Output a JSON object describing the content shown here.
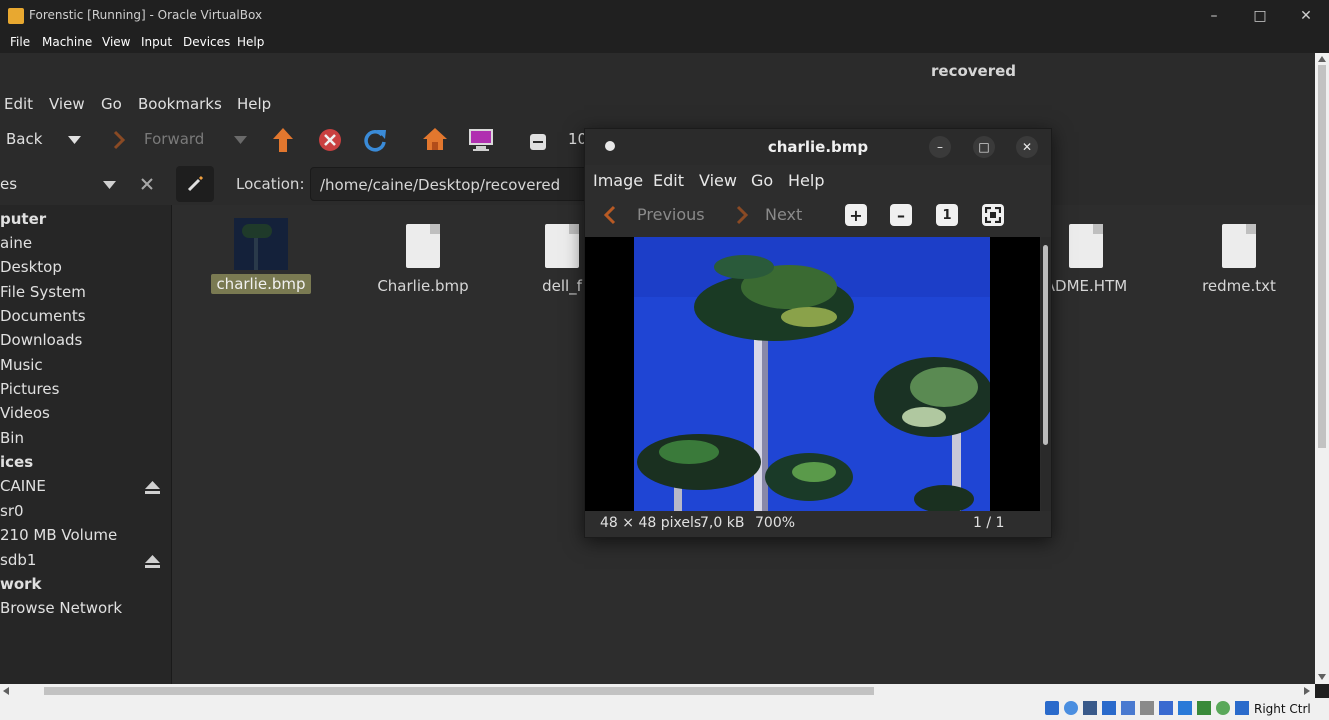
{
  "host_window": {
    "title": "Forenstic [Running] - Oracle VirtualBox",
    "menu": [
      "File",
      "Machine",
      "View",
      "Input",
      "Devices",
      "Help"
    ],
    "status_right": "Right Ctrl"
  },
  "guest": {
    "header_title": "recovered",
    "menu": [
      "Edit",
      "View",
      "Go",
      "Bookmarks",
      "Help"
    ],
    "toolbar": {
      "back_label": "Back",
      "forward_label": "Forward",
      "zoom_partial": "10"
    },
    "location": {
      "label": "Location:",
      "value": "/home/caine/Desktop/recovered"
    },
    "sidebar": {
      "places_label": "es",
      "items": [
        {
          "label": "puter",
          "header": true
        },
        {
          "label": "aine"
        },
        {
          "label": "Desktop"
        },
        {
          "label": "File System"
        },
        {
          "label": "Documents"
        },
        {
          "label": "Downloads"
        },
        {
          "label": "Music"
        },
        {
          "label": "Pictures"
        },
        {
          "label": "Videos"
        },
        {
          "label": "Bin"
        },
        {
          "label": "ices",
          "header": true
        },
        {
          "label": "CAINE",
          "eject": true
        },
        {
          "label": "sr0"
        },
        {
          "label": "210 MB Volume"
        },
        {
          "label": "sdb1",
          "eject": true
        },
        {
          "label": "work",
          "header": true
        },
        {
          "label": "Browse Network"
        }
      ]
    },
    "files": [
      {
        "name": "charlie.bmp",
        "selected": true
      },
      {
        "name": "Charlie.bmp"
      },
      {
        "name": "dell_f"
      },
      {
        "name": "ADME.HTM"
      },
      {
        "name": "redme.txt"
      }
    ]
  },
  "viewer": {
    "title": "charlie.bmp",
    "menu": [
      "Image",
      "Edit",
      "View",
      "Go",
      "Help"
    ],
    "previous_label": "Previous",
    "next_label": "Next",
    "status": {
      "dimensions": "48 × 48 pixels",
      "size": "7,0 kB",
      "zoom": "700%",
      "position": "1 / 1"
    }
  },
  "colors": {
    "accent_orange": "#e2772e",
    "selection": "#7a7a52",
    "sky_blue": "#1f45d4"
  }
}
